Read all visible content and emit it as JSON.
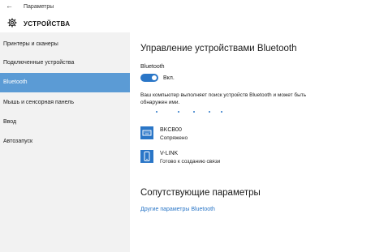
{
  "window": {
    "title": "Параметры"
  },
  "header": {
    "title": "УСТРОЙСТВА"
  },
  "sidebar": {
    "items": [
      {
        "label": "Принтеры и сканеры"
      },
      {
        "label": "Подключенные устройства"
      },
      {
        "label": "Bluetooth",
        "active": true
      },
      {
        "label": "Мышь и сенсорная панель"
      },
      {
        "label": "Ввод"
      },
      {
        "label": "Автозапуск"
      }
    ]
  },
  "main": {
    "title": "Управление устройствами Bluetooth",
    "bluetooth_label": "Bluetooth",
    "toggle_state": "Вкл.",
    "toggle_on": true,
    "scan_text": "Ваш компьютер выполняет поиск устройств Bluetooth и может быть обнаружен ими.",
    "devices": [
      {
        "name": "BKCB00",
        "status": "Сопряжено",
        "icon": "keyboard-icon"
      },
      {
        "name": "V-LINK",
        "status": "Готово к созданию связи",
        "icon": "phone-icon"
      }
    ],
    "related_title": "Сопутствующие параметры",
    "related_link": "Другие параметры Bluetooth"
  },
  "colors": {
    "accent": "#2a76c7",
    "active_item": "#5b9bd5",
    "sidebar_bg": "#f2f2f2"
  }
}
